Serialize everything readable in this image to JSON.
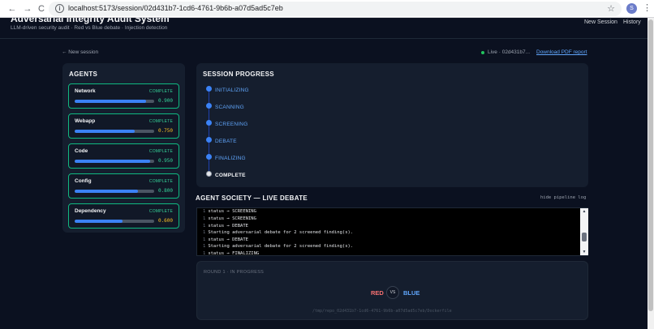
{
  "browser": {
    "url": "localhost:5173/session/02d431b7-1cd6-4761-9b6b-a07d5ad5c7eb",
    "back_glyph": "←",
    "forward_glyph": "→",
    "reload_glyph": "C",
    "info_glyph": "i",
    "star_glyph": "☆",
    "profile_initial": "S",
    "menu_glyph": "⋮"
  },
  "header": {
    "title": "Adversarial Integrity Audit System",
    "subtitle": "LLM-driven security audit · Red vs Blue debate · Injection detection",
    "nav": [
      "New Session",
      "History"
    ]
  },
  "session": {
    "back_label": "← New session",
    "live_label": "Live · 02d431b7...",
    "download_label": "Download PDF report",
    "live_color": "#22c55e"
  },
  "agents": {
    "title": "AGENTS",
    "items": [
      {
        "name": "Network",
        "status": "COMPLETE",
        "score": "0.900",
        "progress": 0.9,
        "score_color": "#34d399"
      },
      {
        "name": "Webapp",
        "status": "COMPLETE",
        "score": "0.750",
        "progress": 0.75,
        "score_color": "#fbbf24"
      },
      {
        "name": "Code",
        "status": "COMPLETE",
        "score": "0.950",
        "progress": 0.95,
        "score_color": "#34d399"
      },
      {
        "name": "Config",
        "status": "COMPLETE",
        "score": "0.800",
        "progress": 0.8,
        "score_color": "#34d399"
      },
      {
        "name": "Dependency",
        "status": "COMPLETE",
        "score": "0.600",
        "progress": 0.6,
        "score_color": "#fbbf24"
      }
    ]
  },
  "progress": {
    "title": "SESSION PROGRESS",
    "steps": [
      "INITIALIZING",
      "SCANNING",
      "SCREENING",
      "DEBATE",
      "FINALIZING",
      "COMPLETE"
    ]
  },
  "debate": {
    "title": "AGENT SOCIETY — LIVE DEBATE",
    "hide_log_label": "hide pipeline log",
    "log_number": "1",
    "log_lines": [
      "status → SCREENING",
      "status → SCREENING",
      "status → DEBATE",
      "Starting adversarial debate for 2 screened finding(s).",
      "status → DEBATE",
      "Starting adversarial debate for 2 screened finding(s).",
      "status → FINALIZING"
    ],
    "scroll_up": "▲",
    "scroll_down": "▼",
    "round_label": "ROUND 1 · IN PROGRESS",
    "red_label": "RED",
    "vs_label": "VS",
    "blue_label": "BLUE",
    "path": "/tmp/repo_02d431b7-1cd6-4761-9b6b-a07d5ad5c7eb/Dockerfile"
  }
}
